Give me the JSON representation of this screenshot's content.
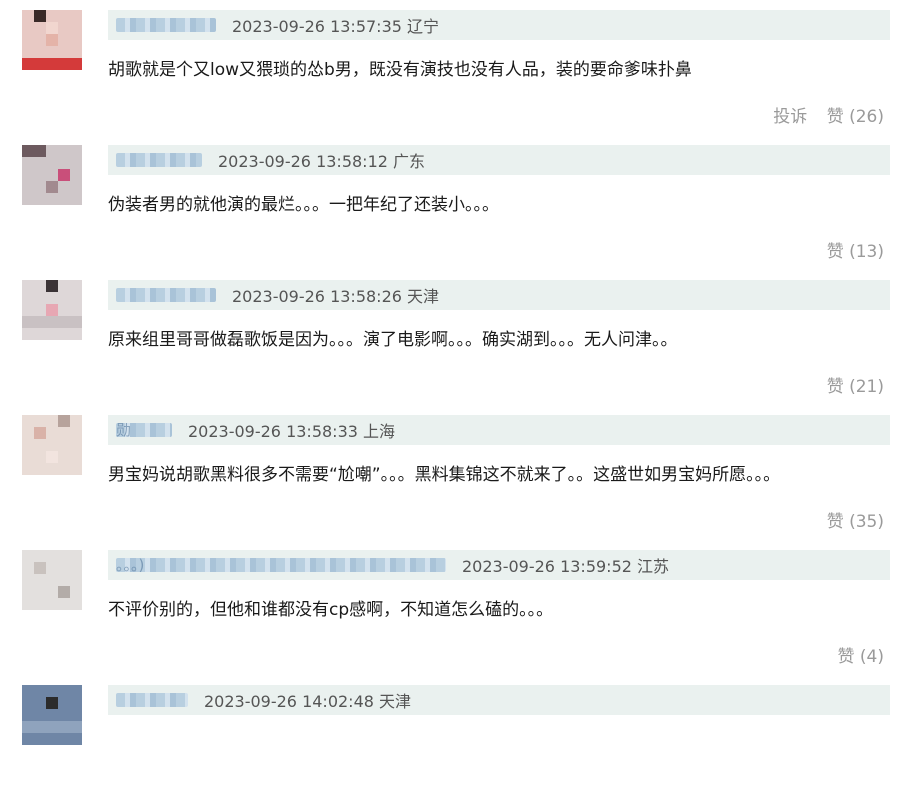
{
  "comments": [
    {
      "username": "",
      "username_tail": "",
      "meta": "2023-09-26 13:57:35 辽宁",
      "text": "胡歌就是个又low又猥琐的怂b男，既没有演技也没有人品，装的要命爹味扑鼻",
      "report_label": "投诉",
      "like_label": "赞 (26)"
    },
    {
      "username": "",
      "username_tail": "",
      "meta": "2023-09-26 13:58:12 广东",
      "text": "伪装者男的就他演的最烂。。。一把年纪了还装小。。。",
      "report_label": "",
      "like_label": "赞 (13)"
    },
    {
      "username": "",
      "username_tail": "",
      "meta": "2023-09-26 13:58:26 天津",
      "text": "原来组里哥哥做磊歌饭是因为。。。演了电影啊。。。确实湖到。。。无人问津。。",
      "report_label": "",
      "like_label": "赞 (21)"
    },
    {
      "username": "",
      "username_tail": "勋",
      "meta": "2023-09-26 13:58:33 上海",
      "text": "男宝妈说胡歌黑料很多不需要“尬嘲”。。。黑料集锦这不就来了。。这盛世如男宝妈所愿。。。",
      "report_label": "",
      "like_label": "赞 (35)"
    },
    {
      "username": "",
      "username_tail": "。。。)",
      "meta": "2023-09-26 13:59:52 江苏",
      "text": "不评价别的，但他和谁都没有cp感啊，不知道怎么磕的。。。",
      "report_label": "",
      "like_label": "赞 (4)"
    },
    {
      "username": "",
      "username_tail": "",
      "meta": "2023-09-26 14:02:48 天津",
      "text": "",
      "report_label": "",
      "like_label": ""
    }
  ],
  "colors": {
    "header_bg": "#eaf1ef",
    "username": "#4a6f95",
    "meta": "#555555",
    "actions": "#9a9a9a"
  }
}
